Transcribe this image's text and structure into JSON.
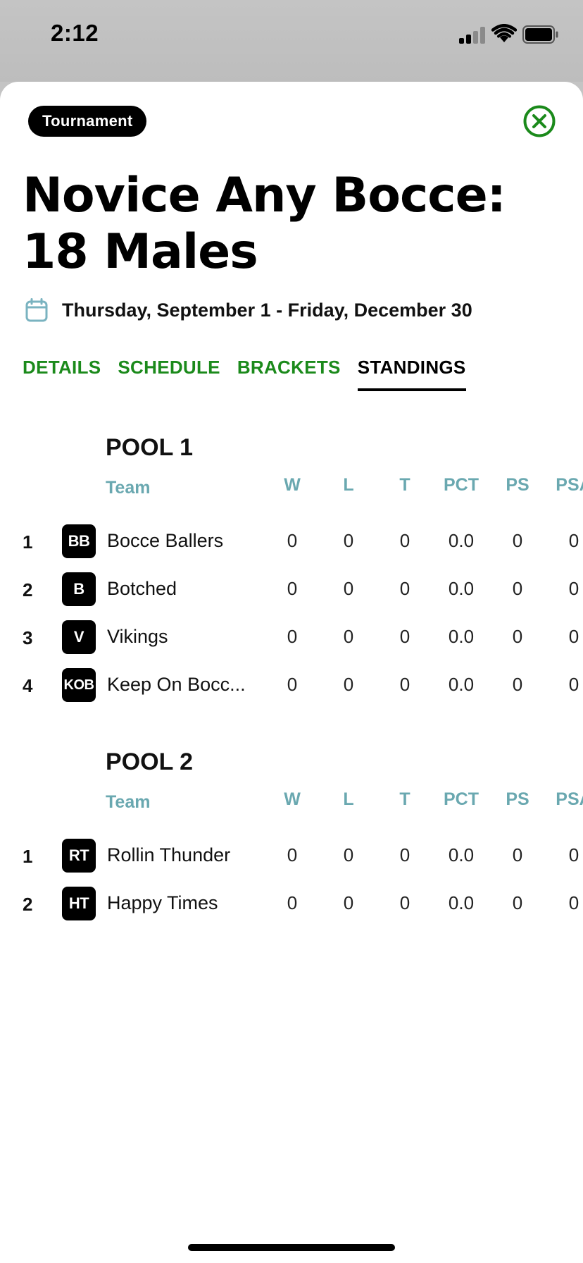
{
  "status": {
    "time": "2:12"
  },
  "header": {
    "badge": "Tournament",
    "title": "Novice Any Bocce: 18 Males",
    "date": "Thursday, September 1 - Friday, December 30"
  },
  "tabs": [
    {
      "label": "DETAILS",
      "active": false
    },
    {
      "label": "SCHEDULE",
      "active": false
    },
    {
      "label": "BRACKETS",
      "active": false
    },
    {
      "label": "STANDINGS",
      "active": true
    }
  ],
  "columns": {
    "team": "Team",
    "w": "W",
    "l": "L",
    "t": "T",
    "pct": "PCT",
    "ps": "PS",
    "psa": "PSA"
  },
  "pools": [
    {
      "title": "POOL 1",
      "teams": [
        {
          "rank": "1",
          "initials": "BB",
          "name": "Bocce Ballers",
          "w": "0",
          "l": "0",
          "t": "0",
          "pct": "0.0",
          "ps": "0",
          "psa": "0"
        },
        {
          "rank": "2",
          "initials": "B",
          "name": "Botched",
          "w": "0",
          "l": "0",
          "t": "0",
          "pct": "0.0",
          "ps": "0",
          "psa": "0"
        },
        {
          "rank": "3",
          "initials": "V",
          "name": "Vikings",
          "w": "0",
          "l": "0",
          "t": "0",
          "pct": "0.0",
          "ps": "0",
          "psa": "0"
        },
        {
          "rank": "4",
          "initials": "KOB",
          "name": "Keep On Bocc...",
          "w": "0",
          "l": "0",
          "t": "0",
          "pct": "0.0",
          "ps": "0",
          "psa": "0"
        }
      ]
    },
    {
      "title": "POOL 2",
      "teams": [
        {
          "rank": "1",
          "initials": "RT",
          "name": "Rollin Thunder",
          "w": "0",
          "l": "0",
          "t": "0",
          "pct": "0.0",
          "ps": "0",
          "psa": "0"
        },
        {
          "rank": "2",
          "initials": "HT",
          "name": "Happy Times",
          "w": "0",
          "l": "0",
          "t": "0",
          "pct": "0.0",
          "ps": "0",
          "psa": "0"
        }
      ]
    }
  ],
  "colors": {
    "accent_green": "#1b8a1b",
    "header_teal": "#6aa8b0",
    "calendar_icon": "#7ab3c0"
  }
}
